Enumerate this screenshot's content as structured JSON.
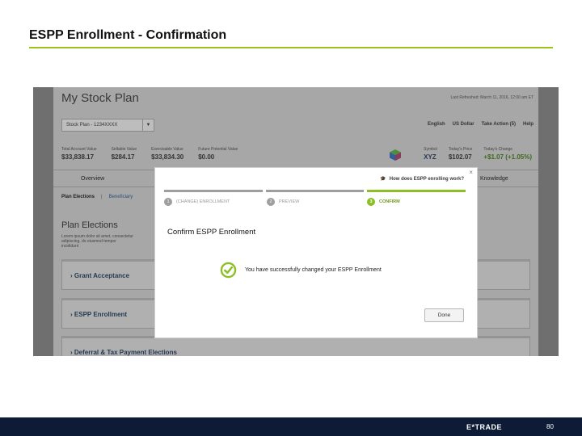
{
  "slide": {
    "title": "ESPP Enrollment - Confirmation",
    "page_number": "80",
    "logo_text": "E*TRADE",
    "accent_color": "#9cc21c",
    "footer_color": "#0d1b36"
  },
  "app": {
    "title": "My Stock Plan",
    "last_refreshed": "Last Refreshed: March 11, 2016, 12:00 am ET",
    "plan_select": {
      "value": "Stock Plan - 1234XXXX"
    },
    "toolbar": {
      "language": "English",
      "currency": "US Dollar",
      "take_action": "Take Action (5)",
      "help": "Help"
    },
    "stats": [
      {
        "label": "Total Account Value",
        "value": "$33,838.17"
      },
      {
        "label": "Sellable Value",
        "value": "$284.17"
      },
      {
        "label": "Exercisable Value",
        "value": "$33,834.30"
      },
      {
        "label": "Future Potential Value",
        "value": "$0.00"
      }
    ],
    "stock": {
      "symbol_label": "Symbol",
      "symbol": "XYZ",
      "price_label": "Today's Price",
      "price": "$102.07",
      "change_label": "Today's Change",
      "change": "+$1.07 (+1.05%)",
      "change_color": "#3d6a1d"
    },
    "tabs": {
      "overview": "Overview",
      "knowledge": "Knowledge"
    },
    "subnav": {
      "active": "Plan Elections",
      "next": "Beneficiary"
    },
    "section_title": "Plan Elections",
    "intro_text": "Lorem ipsum dolor sit amet, consectetur adipiscing, do eiusmod tempor incididunt",
    "panels": [
      {
        "label": "Grant Acceptance"
      },
      {
        "label": "ESPP Enrollment"
      },
      {
        "label": "Deferral & Tax Payment Elections"
      }
    ]
  },
  "modal": {
    "help_link": "How does ESPP enrolling work?",
    "close_label": "×",
    "steps": [
      {
        "num": "1",
        "label": "(CHANGE) ENROLLMENT",
        "active": false
      },
      {
        "num": "2",
        "label": "PREVIEW",
        "active": false
      },
      {
        "num": "3",
        "label": "CONFIRM",
        "active": true
      }
    ],
    "title": "Confirm ESPP Enrollment",
    "success_message": "You have successfully changed your ESPP Enrollment",
    "done_label": "Done",
    "step_active_color": "#8cbf26"
  }
}
